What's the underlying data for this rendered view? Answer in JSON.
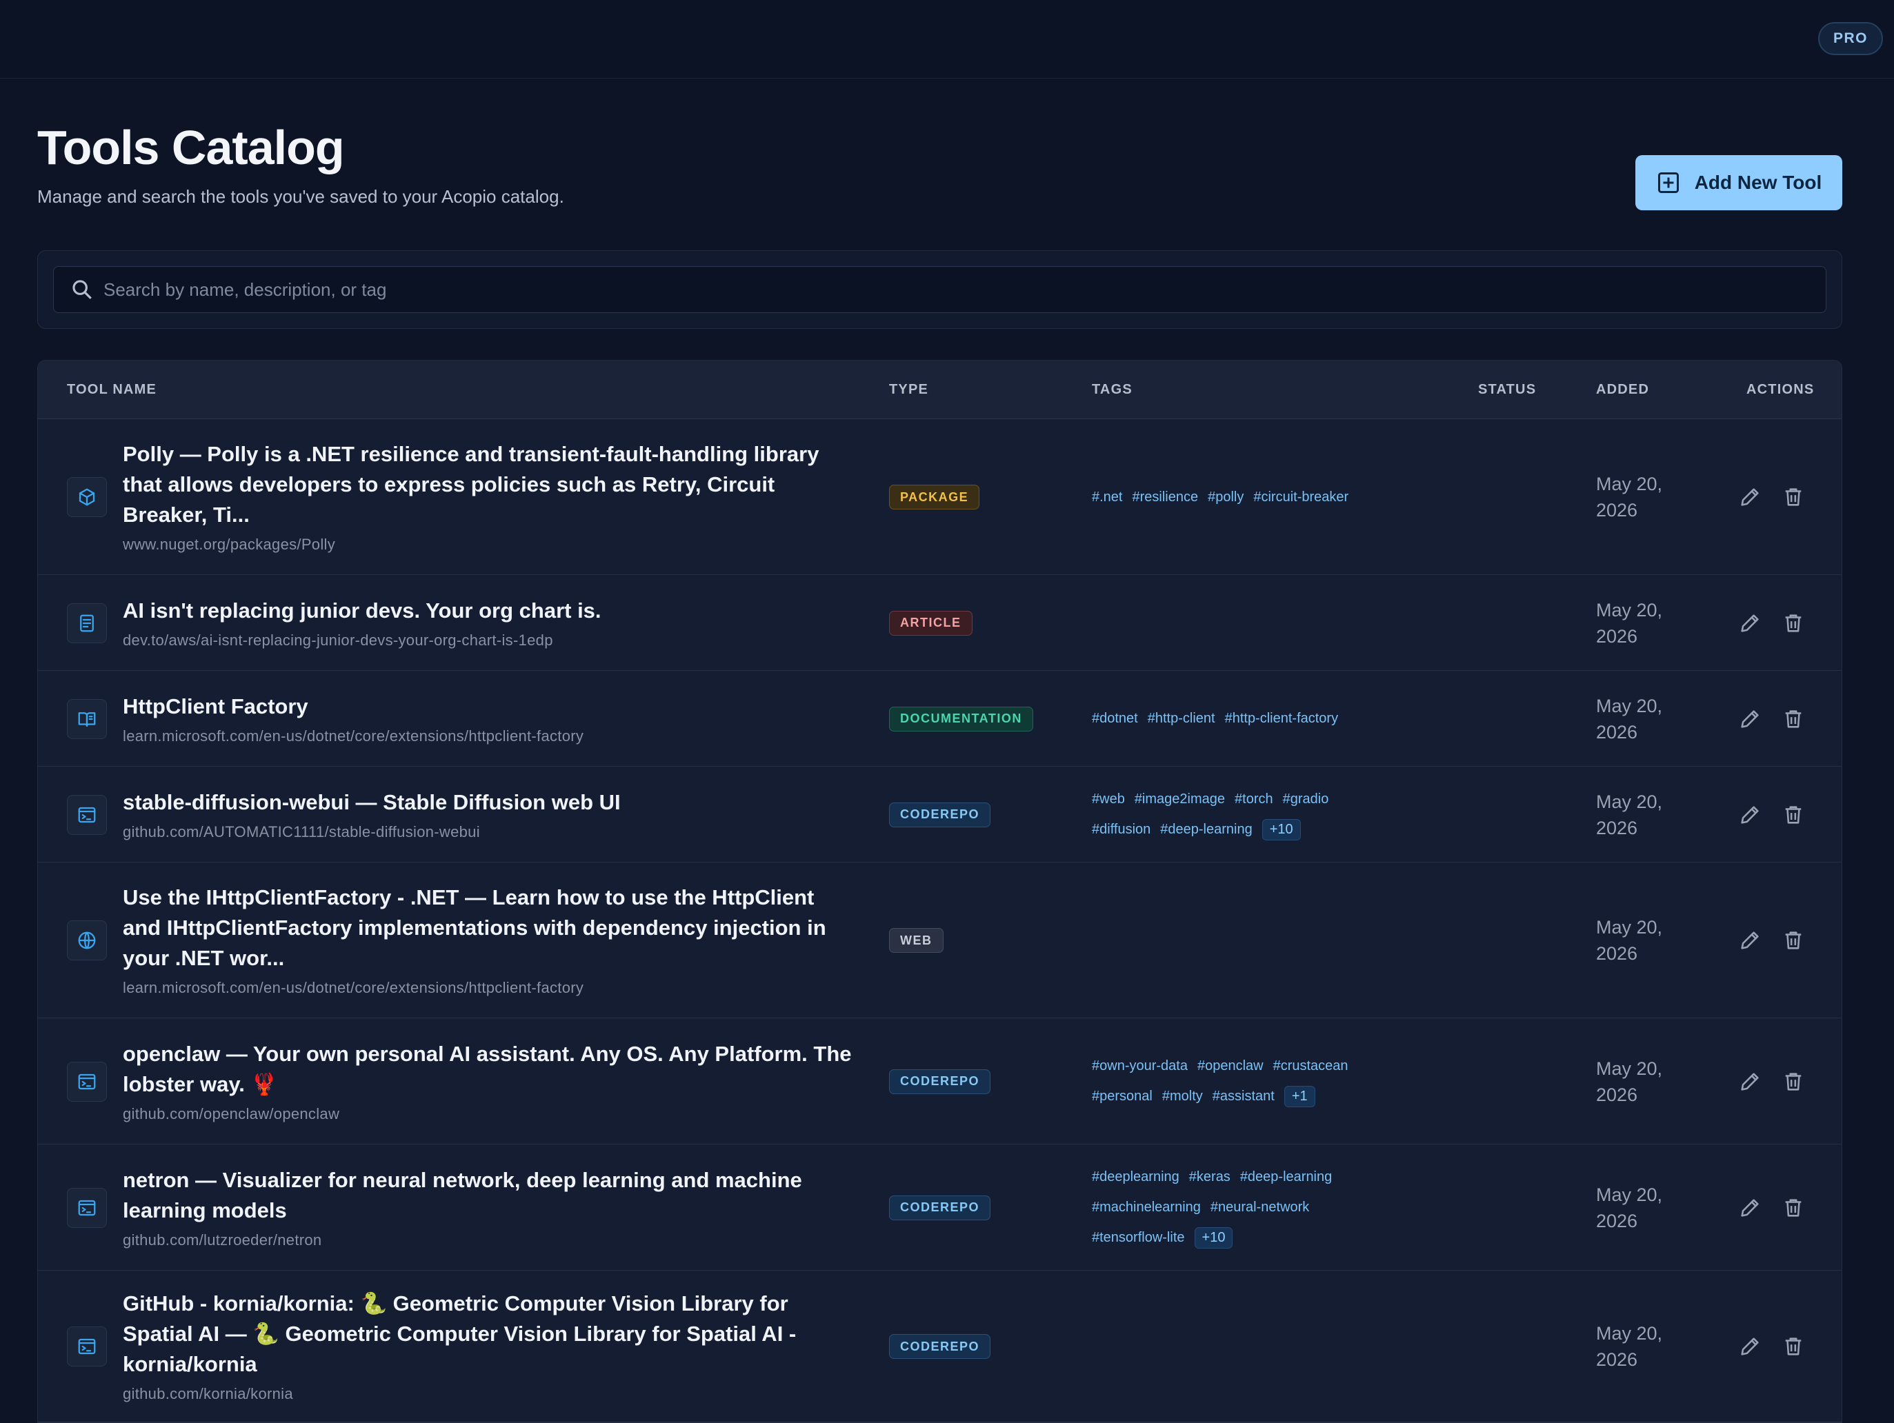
{
  "topbar": {
    "badge": "PRO"
  },
  "header": {
    "title": "Tools Catalog",
    "subtitle": "Manage and search the tools you've saved to your Acopio catalog.",
    "add_button": "Add New Tool"
  },
  "search": {
    "placeholder": "Search by name, description, or tag",
    "value": ""
  },
  "table": {
    "columns": [
      "TOOL NAME",
      "TYPE",
      "TAGS",
      "STATUS",
      "ADDED",
      "ACTIONS"
    ],
    "rows": [
      {
        "icon": "package-icon",
        "title_lines": [
          "Polly — Polly is a .NET resilience and transient-fault-handling library",
          "that allows developers to express policies such as Retry, Circuit",
          "Breaker, Ti..."
        ],
        "url": "www.nuget.org/packages/Polly",
        "type": "PACKAGE",
        "tag_lines": [
          [
            "#.net",
            "#resilience",
            "#polly",
            "#circuit-breaker"
          ]
        ],
        "more": "",
        "added": [
          "May 20,",
          "2026"
        ]
      },
      {
        "icon": "article-icon",
        "title_lines": [
          "AI isn't replacing junior devs. Your org chart is."
        ],
        "url": "dev.to/aws/ai-isnt-replacing-junior-devs-your-org-chart-is-1edp",
        "type": "ARTICLE",
        "tag_lines": [],
        "more": "",
        "added": [
          "May 20,",
          "2026"
        ]
      },
      {
        "icon": "documentation-icon",
        "title_lines": [
          "HttpClient Factory"
        ],
        "url": "learn.microsoft.com/en-us/dotnet/core/extensions/httpclient-factory",
        "type": "DOCUMENTATION",
        "tag_lines": [
          [
            "#dotnet",
            "#http-client",
            "#http-client-factory"
          ]
        ],
        "more": "",
        "added": [
          "May 20,",
          "2026"
        ]
      },
      {
        "icon": "terminal-icon",
        "title_lines": [
          "stable-diffusion-webui — Stable Diffusion web UI"
        ],
        "url": "github.com/AUTOMATIC1111/stable-diffusion-webui",
        "type": "CODEREPO",
        "tag_lines": [
          [
            "#web",
            "#image2image",
            "#torch",
            "#gradio"
          ],
          [
            "#diffusion",
            "#deep-learning"
          ]
        ],
        "more": "+10",
        "added": [
          "May 20,",
          "2026"
        ]
      },
      {
        "icon": "globe-icon",
        "title_lines": [
          "Use the IHttpClientFactory - .NET — Learn how to use the HttpClient",
          "and IHttpClientFactory implementations with dependency injection in",
          "your .NET wor..."
        ],
        "url": "learn.microsoft.com/en-us/dotnet/core/extensions/httpclient-factory",
        "type": "WEB",
        "tag_lines": [],
        "more": "",
        "added": [
          "May 20,",
          "2026"
        ]
      },
      {
        "icon": "terminal-icon",
        "title_lines": [
          "openclaw — Your own personal AI assistant. Any OS. Any Platform. The",
          "lobster way. 🦞"
        ],
        "url": "github.com/openclaw/openclaw",
        "type": "CODEREPO",
        "tag_lines": [
          [
            "#own-your-data",
            "#openclaw",
            "#crustacean"
          ],
          [
            "#personal",
            "#molty",
            "#assistant"
          ]
        ],
        "more": "+1",
        "added": [
          "May 20,",
          "2026"
        ]
      },
      {
        "icon": "terminal-icon",
        "title_lines": [
          "netron — Visualizer for neural network, deep learning and machine",
          "learning models"
        ],
        "url": "github.com/lutzroeder/netron",
        "type": "CODEREPO",
        "tag_lines": [
          [
            "#deeplearning",
            "#keras",
            "#deep-learning"
          ],
          [
            "#machinelearning",
            "#neural-network"
          ],
          [
            "#tensorflow-lite"
          ]
        ],
        "more": "+10",
        "added": [
          "May 20,",
          "2026"
        ]
      },
      {
        "icon": "terminal-icon",
        "title_lines": [
          "GitHub - kornia/kornia: 🐍 Geometric Computer Vision Library for",
          "Spatial AI — 🐍 Geometric Computer Vision Library for Spatial AI -",
          "kornia/kornia"
        ],
        "url": "github.com/kornia/kornia",
        "type": "CODEREPO",
        "tag_lines": [],
        "more": "",
        "added": [
          "May 20,",
          "2026"
        ]
      }
    ]
  },
  "colors": {
    "PACKAGE": {
      "fg": "#f3c04a",
      "bg": "#3a2e14",
      "border": "#6a5320"
    },
    "ARTICLE": {
      "fg": "#f3a3a3",
      "bg": "#3a1e24",
      "border": "#6b3840"
    },
    "DOCUMENTATION": {
      "fg": "#49d6b0",
      "bg": "#103a34",
      "border": "#1f6656"
    },
    "CODEREPO": {
      "fg": "#88c8f4",
      "bg": "#15304e",
      "border": "#2a507a"
    },
    "WEB": {
      "fg": "#c9cfd9",
      "bg": "#2a3142",
      "border": "#434c5f"
    }
  }
}
